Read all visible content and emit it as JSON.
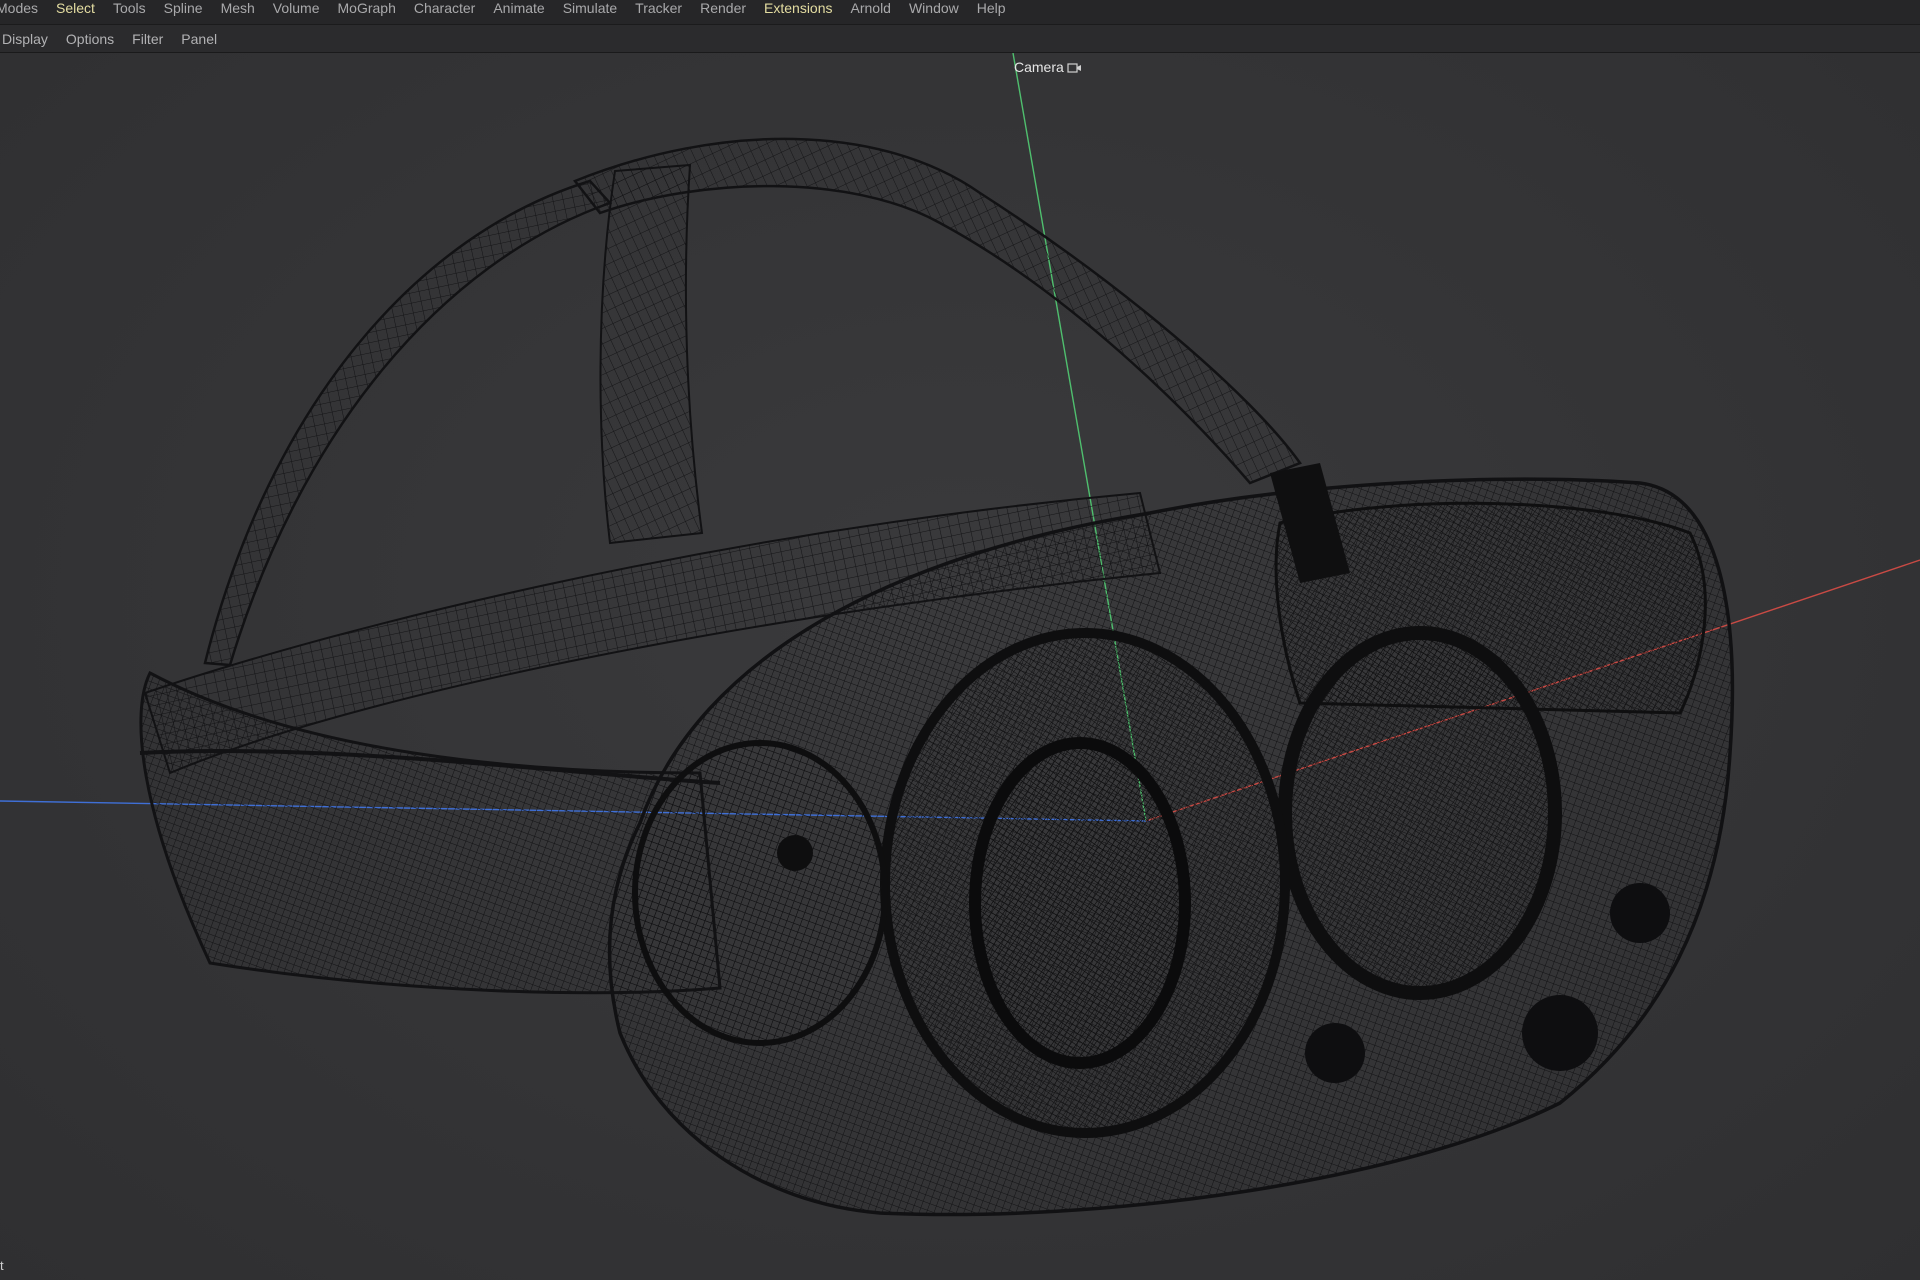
{
  "menubar": {
    "items": [
      "Modes",
      "Select",
      "Tools",
      "Spline",
      "Mesh",
      "Volume",
      "MoGraph",
      "Character",
      "Animate",
      "Simulate",
      "Tracker",
      "Render",
      "Extensions",
      "Arnold",
      "Window",
      "Help"
    ],
    "highlighted": [
      "Select",
      "Extensions"
    ],
    "highlight_color": "#e3dca1"
  },
  "viewport_menu": {
    "items": [
      "Display",
      "Options",
      "Filter",
      "Panel"
    ]
  },
  "viewport": {
    "camera_label": "Camera",
    "camera_icon": "camera-icon",
    "corner_text": "t",
    "object": "vr-headset-wireframe",
    "axis_colors": {
      "x": "#c94a44",
      "y": "#4fbf6e",
      "z": "#3f6fd6"
    }
  }
}
